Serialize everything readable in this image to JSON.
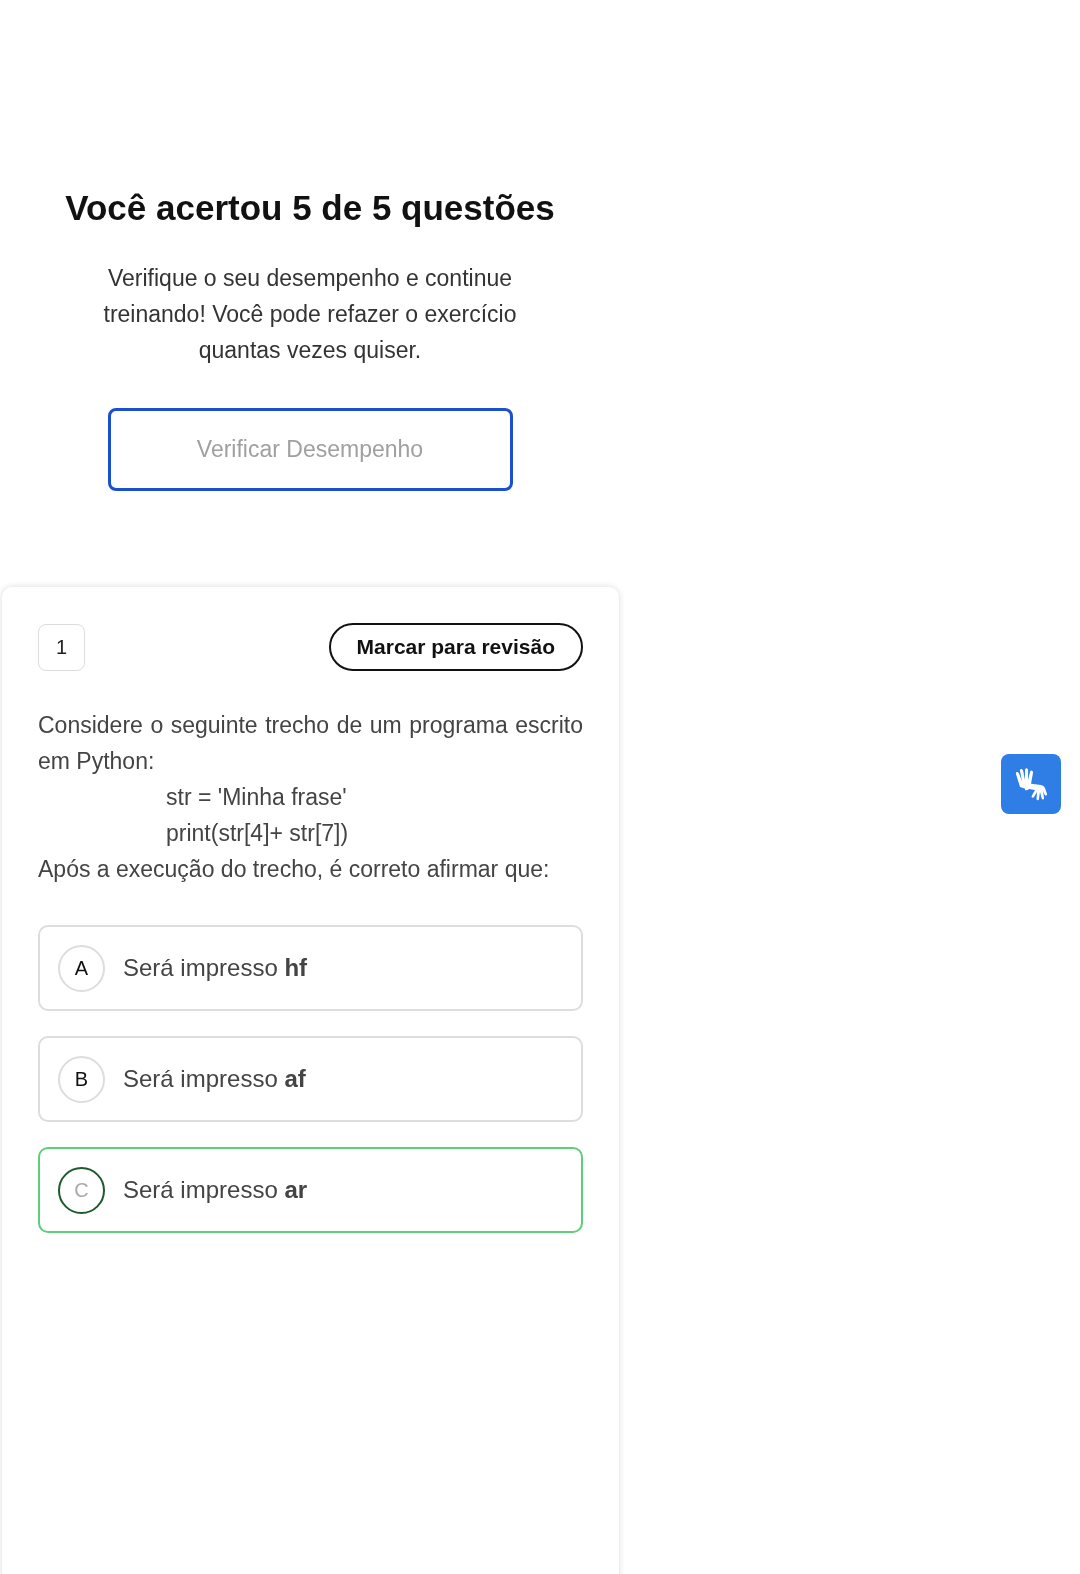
{
  "result": {
    "title": "Você acertou 5 de 5 questões",
    "message": "Verifique o seu desempenho e continue treinando! Você pode refazer o exercício quantas vezes quiser.",
    "button": "Verificar Desempenho"
  },
  "question": {
    "number": "1",
    "review_button": "Marcar para revisão",
    "intro": "Considere o seguinte trecho de um programa escrito em Python:",
    "code": [
      "str = 'Minha frase'",
      "print(str[4]+ str[7])"
    ],
    "closing": "Após a execução do trecho, é correto afirmar que:",
    "options": [
      {
        "letter": "A",
        "text": "Será impresso **hf**",
        "selected": false
      },
      {
        "letter": "B",
        "text": "Será impresso **af**",
        "selected": false
      },
      {
        "letter": "C",
        "text": "Será impresso **ar**",
        "selected": true
      }
    ]
  }
}
